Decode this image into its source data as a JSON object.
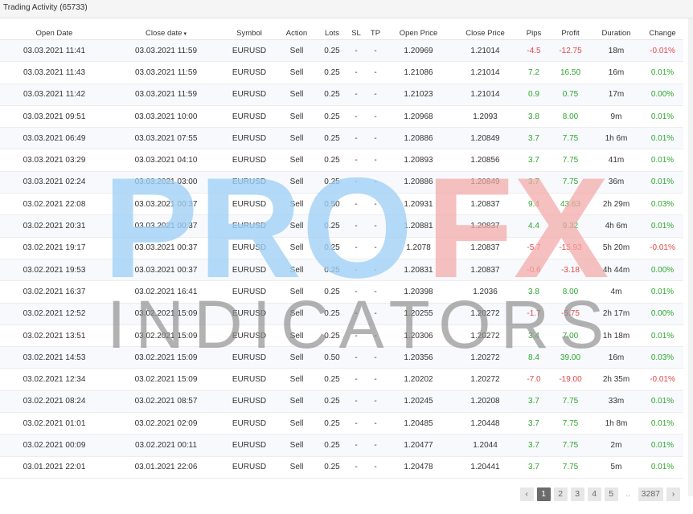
{
  "header": {
    "title": "Trading Activity (65733)"
  },
  "table": {
    "columns": [
      "Open Date",
      "Close date",
      "Symbol",
      "Action",
      "Lots",
      "SL",
      "TP",
      "Open Price",
      "Close Price",
      "Pips",
      "Profit",
      "Duration",
      "Change"
    ],
    "sort_indicator": "▾",
    "rows": [
      [
        "03.03.2021 11:41",
        "03.03.2021 11:59",
        "EURUSD",
        "Sell",
        "0.25",
        "-",
        "-",
        "1.20969",
        "1.21014",
        "-4.5",
        "-12.75",
        "18m",
        "-0.01%"
      ],
      [
        "03.03.2021 11:43",
        "03.03.2021 11:59",
        "EURUSD",
        "Sell",
        "0.25",
        "-",
        "-",
        "1.21086",
        "1.21014",
        "7.2",
        "16.50",
        "16m",
        "0.01%"
      ],
      [
        "03.03.2021 11:42",
        "03.03.2021 11:59",
        "EURUSD",
        "Sell",
        "0.25",
        "-",
        "-",
        "1.21023",
        "1.21014",
        "0.9",
        "0.75",
        "17m",
        "0.00%"
      ],
      [
        "03.03.2021 09:51",
        "03.03.2021 10:00",
        "EURUSD",
        "Sell",
        "0.25",
        "-",
        "-",
        "1.20968",
        "1.2093",
        "3.8",
        "8.00",
        "9m",
        "0.01%"
      ],
      [
        "03.03.2021 06:49",
        "03.03.2021 07:55",
        "EURUSD",
        "Sell",
        "0.25",
        "-",
        "-",
        "1.20886",
        "1.20849",
        "3.7",
        "7.75",
        "1h 6m",
        "0.01%"
      ],
      [
        "03.03.2021 03:29",
        "03.03.2021 04:10",
        "EURUSD",
        "Sell",
        "0.25",
        "-",
        "-",
        "1.20893",
        "1.20856",
        "3.7",
        "7.75",
        "41m",
        "0.01%"
      ],
      [
        "03.03.2021 02:24",
        "03.03.2021 03:00",
        "EURUSD",
        "Sell",
        "0.25",
        "-",
        "-",
        "1.20886",
        "1.20849",
        "3.7",
        "7.75",
        "36m",
        "0.01%"
      ],
      [
        "03.02.2021 22:08",
        "03.03.2021 00:37",
        "EURUSD",
        "Sell",
        "0.50",
        "-",
        "-",
        "1.20931",
        "1.20837",
        "9.4",
        "43.63",
        "2h 29m",
        "0.03%"
      ],
      [
        "03.02.2021 20:31",
        "03.03.2021 00:37",
        "EURUSD",
        "Sell",
        "0.25",
        "-",
        "-",
        "1.20881",
        "1.20837",
        "4.4",
        "9.32",
        "4h 6m",
        "0.01%"
      ],
      [
        "03.02.2021 19:17",
        "03.03.2021 00:37",
        "EURUSD",
        "Sell",
        "0.25",
        "-",
        "-",
        "1.2078",
        "1.20837",
        "-5.7",
        "-15.93",
        "5h 20m",
        "-0.01%"
      ],
      [
        "03.02.2021 19:53",
        "03.03.2021 00:37",
        "EURUSD",
        "Sell",
        "0.25",
        "-",
        "-",
        "1.20831",
        "1.20837",
        "-0.6",
        "-3.18",
        "4h 44m",
        "0.00%"
      ],
      [
        "03.02.2021 16:37",
        "03.02.2021 16:41",
        "EURUSD",
        "Sell",
        "0.25",
        "-",
        "-",
        "1.20398",
        "1.2036",
        "3.8",
        "8.00",
        "4m",
        "0.01%"
      ],
      [
        "03.02.2021 12:52",
        "03.02.2021 15:09",
        "EURUSD",
        "Sell",
        "0.25",
        "-",
        "-",
        "1.20255",
        "1.20272",
        "-1.7",
        "-5.75",
        "2h 17m",
        "0.00%"
      ],
      [
        "03.02.2021 13:51",
        "03.02.2021 15:09",
        "EURUSD",
        "Sell",
        "0.25",
        "-",
        "-",
        "1.20306",
        "1.20272",
        "3.4",
        "7.00",
        "1h 18m",
        "0.01%"
      ],
      [
        "03.02.2021 14:53",
        "03.02.2021 15:09",
        "EURUSD",
        "Sell",
        "0.50",
        "-",
        "-",
        "1.20356",
        "1.20272",
        "8.4",
        "39.00",
        "16m",
        "0.03%"
      ],
      [
        "03.02.2021 12:34",
        "03.02.2021 15:09",
        "EURUSD",
        "Sell",
        "0.25",
        "-",
        "-",
        "1.20202",
        "1.20272",
        "-7.0",
        "-19.00",
        "2h 35m",
        "-0.01%"
      ],
      [
        "03.02.2021 08:24",
        "03.02.2021 08:57",
        "EURUSD",
        "Sell",
        "0.25",
        "-",
        "-",
        "1.20245",
        "1.20208",
        "3.7",
        "7.75",
        "33m",
        "0.01%"
      ],
      [
        "03.02.2021 01:01",
        "03.02.2021 02:09",
        "EURUSD",
        "Sell",
        "0.25",
        "-",
        "-",
        "1.20485",
        "1.20448",
        "3.7",
        "7.75",
        "1h 8m",
        "0.01%"
      ],
      [
        "03.02.2021 00:09",
        "03.02.2021 00:11",
        "EURUSD",
        "Sell",
        "0.25",
        "-",
        "-",
        "1.20477",
        "1.2044",
        "3.7",
        "7.75",
        "2m",
        "0.01%"
      ],
      [
        "03.01.2021 22:01",
        "03.01.2021 22:06",
        "EURUSD",
        "Sell",
        "0.25",
        "-",
        "-",
        "1.20478",
        "1.20441",
        "3.7",
        "7.75",
        "5m",
        "0.01%"
      ]
    ]
  },
  "pagination": {
    "prev_icon": "‹",
    "pages": [
      "1",
      "2",
      "3",
      "4",
      "5"
    ],
    "active": "1",
    "ellipsis": "..",
    "last": "3287",
    "next_icon": "›"
  },
  "watermark": {
    "line1_part1": "PRO",
    "line1_part2": "FX",
    "line2": "INDICATORS",
    "color_blue": "#9fd0f5",
    "color_red": "#f3a7a7",
    "color_grey": "#8d8d8d"
  },
  "colors": {
    "positive": "#2fa52f",
    "negative": "#e24747"
  }
}
